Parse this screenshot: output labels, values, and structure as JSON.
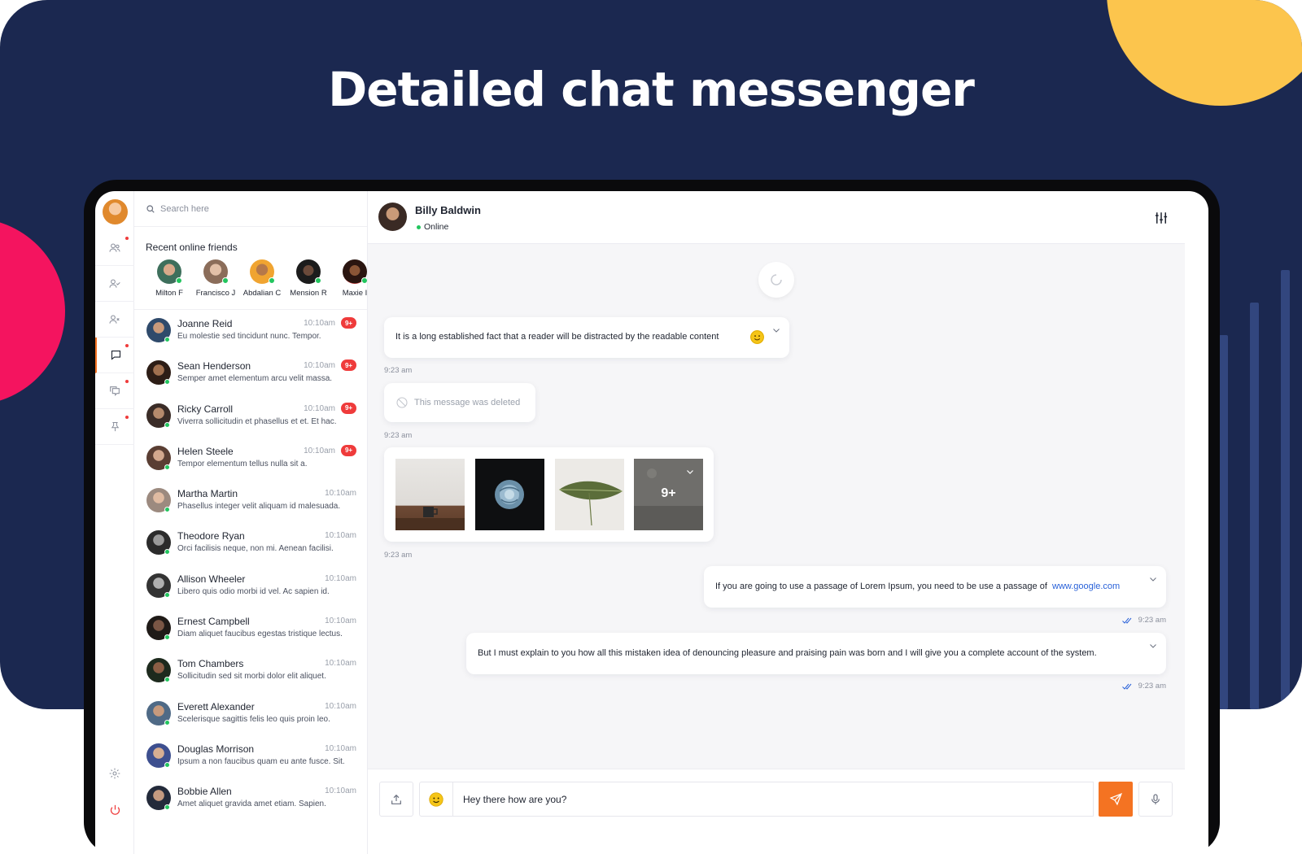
{
  "hero": {
    "title": "Detailed chat messenger"
  },
  "colors": {
    "navy": "#1b2850",
    "accent": "#f47322",
    "yellow": "#fcc54d",
    "pink": "#f4145f",
    "online": "#22c55e",
    "badge": "#ef3b3b",
    "link": "#2a62d9"
  },
  "rail": {
    "items": [
      {
        "icon": "users-icon",
        "notify": true
      },
      {
        "icon": "user-check-icon",
        "notify": false
      },
      {
        "icon": "user-x-icon",
        "notify": false
      },
      {
        "icon": "chat-icon",
        "notify": true,
        "active": true
      },
      {
        "icon": "group-chat-icon",
        "notify": true
      },
      {
        "icon": "pin-icon",
        "notify": true
      }
    ],
    "bottom": [
      "settings-icon",
      "power-icon"
    ]
  },
  "search": {
    "placeholder": "Search here",
    "value": ""
  },
  "online": {
    "title": "Recent online friends",
    "friends": [
      {
        "name": "Milton F"
      },
      {
        "name": "Francisco J"
      },
      {
        "name": "Abdalian C"
      },
      {
        "name": "Mension R"
      },
      {
        "name": "Maxie I"
      }
    ]
  },
  "contacts": [
    {
      "name": "Joanne Reid",
      "time": "10:10am",
      "message": "Eu molestie sed tincidunt nunc. Tempor.",
      "unread": "9+"
    },
    {
      "name": "Sean Henderson",
      "time": "10:10am",
      "message": "Semper amet elementum arcu velit massa.",
      "unread": "9+"
    },
    {
      "name": "Ricky Carroll",
      "time": "10:10am",
      "message": "Viverra sollicitudin et phasellus et et. Et hac.",
      "unread": "9+"
    },
    {
      "name": "Helen Steele",
      "time": "10:10am",
      "message": "Tempor elementum tellus nulla sit a.",
      "unread": "9+"
    },
    {
      "name": "Martha Martin",
      "time": "10:10am",
      "message": "Phasellus integer velit aliquam id malesuada.",
      "unread": ""
    },
    {
      "name": "Theodore Ryan",
      "time": "10:10am",
      "message": "Orci facilisis neque, non mi. Aenean facilisi.",
      "unread": ""
    },
    {
      "name": "Allison Wheeler",
      "time": "10:10am",
      "message": "Libero quis odio morbi id vel. Ac sapien id.",
      "unread": ""
    },
    {
      "name": "Ernest Campbell",
      "time": "10:10am",
      "message": "Diam aliquet faucibus egestas tristique lectus.",
      "unread": ""
    },
    {
      "name": "Tom Chambers",
      "time": "10:10am",
      "message": "Sollicitudin sed sit morbi dolor elit aliquet.",
      "unread": ""
    },
    {
      "name": "Everett Alexander",
      "time": "10:10am",
      "message": "Scelerisque sagittis felis leo quis proin leo.",
      "unread": ""
    },
    {
      "name": "Douglas Morrison",
      "time": "10:10am",
      "message": "Ipsum a non faucibus quam eu ante fusce. Sit.",
      "unread": ""
    },
    {
      "name": "Bobbie Allen",
      "time": "10:10am",
      "message": "Amet aliquet gravida amet etiam. Sapien.",
      "unread": ""
    }
  ],
  "chat": {
    "contact_name": "Billy Baldwin",
    "status": "Online",
    "messages": {
      "m1": {
        "text": "It is a long established fact that a reader will be distracted by the readable content",
        "time": "9:23 am"
      },
      "m2": {
        "text": "This message was deleted",
        "time": "9:23 am"
      },
      "m3": {
        "more": "9+",
        "time": "9:23 am"
      },
      "m4": {
        "text": "If you are going to use a passage of Lorem Ipsum, you need to be use a passage of",
        "link": "www.google.com",
        "time": "9:23 am"
      },
      "m5": {
        "text": "But I must explain to you how all this mistaken idea of denouncing pleasure and praising pain was born and I will give you a complete account of the system.",
        "time": "9:23 am"
      }
    }
  },
  "composer": {
    "value": "Hey there how are you?",
    "placeholder": ""
  }
}
